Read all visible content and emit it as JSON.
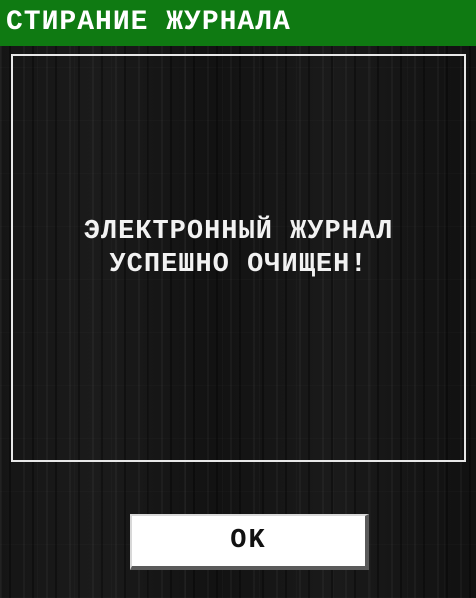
{
  "window": {
    "title": "СТИРАНИЕ ЖУРНАЛА"
  },
  "message": {
    "line1": "ЭЛЕКТРОННЫЙ ЖУРНАЛ",
    "line2": "УСПЕШНО ОЧИЩЕН!"
  },
  "buttons": {
    "ok_label": "OK"
  },
  "colors": {
    "title_bar": "#0f7a12",
    "background": "#151515",
    "text": "#ffffff"
  }
}
